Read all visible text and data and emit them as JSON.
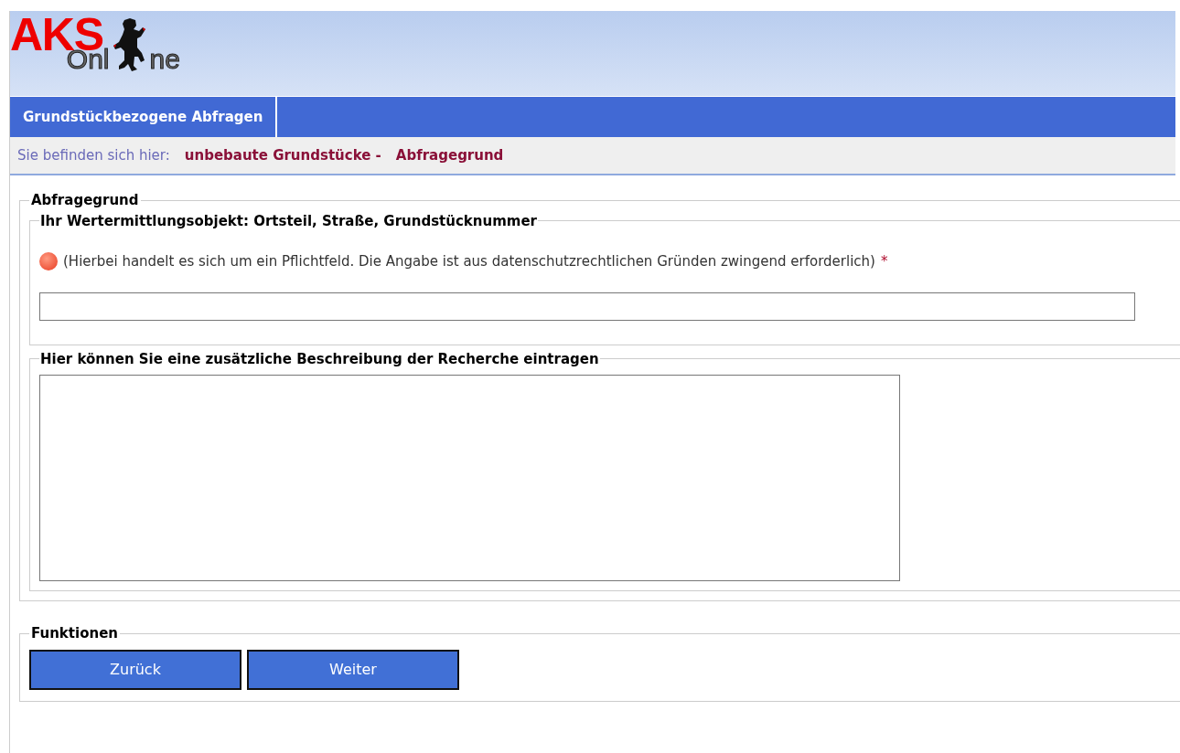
{
  "logo": {
    "primary": "AKS",
    "secondary_left": "Onl",
    "secondary_right": "ne"
  },
  "tabs": [
    {
      "label": "Grundstückbezogene Abfragen",
      "selected": true
    }
  ],
  "breadcrumb": {
    "label": "Sie befinden sich hier:",
    "items": [
      "unbebaute Grundstücke -",
      "Abfragegrund"
    ]
  },
  "form": {
    "legend": "Abfragegrund",
    "object_group": {
      "legend": "Ihr Wertermittlungsobjekt: Ortsteil, Straße, Grundstücknummer",
      "hint": "(Hierbei handelt es sich um ein Pflichtfeld. Die Angabe ist aus datenschutzrechtlichen Gründen zwingend erforderlich)",
      "required_mark": "*",
      "required": true
    },
    "description_group": {
      "legend": "Hier können Sie eine zusätzliche Beschreibung der Recherche eintragen"
    }
  },
  "functions": {
    "legend": "Funktionen",
    "buttons": [
      "Zurück",
      "Weiter"
    ]
  }
}
